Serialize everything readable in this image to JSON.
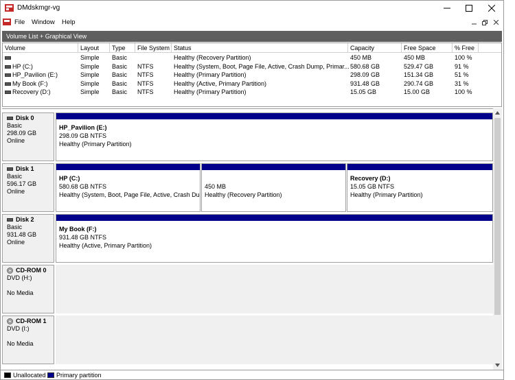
{
  "window": {
    "title": "DMdskmgr-vg",
    "minimize_icon": "minimize-icon",
    "maximize_icon": "maximize-icon",
    "close_icon": "close-icon"
  },
  "menu": {
    "items": [
      "File",
      "Window",
      "Help"
    ]
  },
  "pane_header": {
    "title": "Volume List + Graphical View"
  },
  "volume_list": {
    "columns": [
      "Volume",
      "Layout",
      "Type",
      "File System",
      "Status",
      "Capacity",
      "Free Space",
      "% Free"
    ],
    "rows": [
      [
        "",
        "Simple",
        "Basic",
        "",
        "Healthy (Recovery Partition)",
        "450 MB",
        "450 MB",
        "100 %"
      ],
      [
        "HP (C:)",
        "Simple",
        "Basic",
        "NTFS",
        "Healthy (System, Boot, Page File, Active, Crash Dump, Primar...",
        "580.68 GB",
        "529.47 GB",
        "91 %"
      ],
      [
        "HP_Pavilion (E:)",
        "Simple",
        "Basic",
        "NTFS",
        "Healthy (Primary Partition)",
        "298.09 GB",
        "151.34 GB",
        "51 %"
      ],
      [
        "My Book (F:)",
        "Simple",
        "Basic",
        "NTFS",
        "Healthy (Active, Primary Partition)",
        "931.48 GB",
        "290.74 GB",
        "31 %"
      ],
      [
        "Recovery (D:)",
        "Simple",
        "Basic",
        "NTFS",
        "Healthy (Primary Partition)",
        "15.05 GB",
        "15.00 GB",
        "100 %"
      ]
    ]
  },
  "disks": [
    {
      "name": "Disk 0",
      "type": "Basic",
      "size": "298.09 GB",
      "state": "Online",
      "partitions": [
        {
          "name": "HP_Pavilion  (E:)",
          "size": "298.09 GB NTFS",
          "status": "Healthy (Primary Partition)"
        }
      ]
    },
    {
      "name": "Disk 1",
      "type": "Basic",
      "size": "596.17 GB",
      "state": "Online",
      "partitions": [
        {
          "name": "HP  (C:)",
          "size": "580.68 GB NTFS",
          "status": "Healthy (System, Boot, Page File, Active, Crash Dun"
        },
        {
          "name": "",
          "size": "450 MB",
          "status": "Healthy (Recovery Partition)"
        },
        {
          "name": "Recovery  (D:)",
          "size": "15.05 GB NTFS",
          "status": "Healthy (Primary Partition)"
        }
      ]
    },
    {
      "name": "Disk 2",
      "type": "Basic",
      "size": "931.48 GB",
      "state": "Online",
      "partitions": [
        {
          "name": "My Book  (F:)",
          "size": "931.48 GB NTFS",
          "status": "Healthy (Active, Primary Partition)"
        }
      ]
    }
  ],
  "cdroms": [
    {
      "name": "CD-ROM 0",
      "drive": "DVD (H:)",
      "media": "No Media"
    },
    {
      "name": "CD-ROM 1",
      "drive": "DVD (I:)",
      "media": "No Media"
    }
  ],
  "legend": {
    "items": [
      {
        "label": "Unallocated",
        "color": "#000000"
      },
      {
        "label": "Primary partition",
        "color": "#00008b"
      }
    ]
  },
  "colors": {
    "partition_bar": "#00008b",
    "pane_header": "#5f5f5f"
  }
}
